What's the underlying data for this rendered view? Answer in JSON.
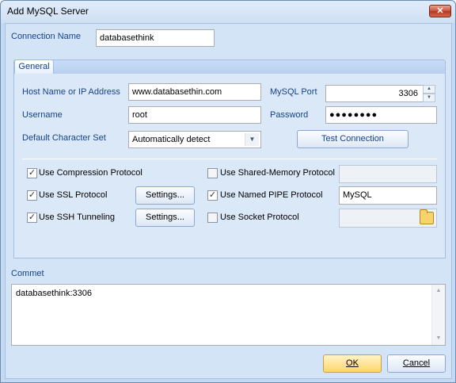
{
  "window": {
    "title": "Add MySQL Server",
    "close_label": "✕"
  },
  "connection": {
    "label": "Connection Name",
    "value": "databasethink"
  },
  "tabs": [
    {
      "label": "General"
    }
  ],
  "general": {
    "host_label": "Host Name or IP Address",
    "host_value": "www.databasethin.com",
    "port_label": "MySQL Port",
    "port_value": "3306",
    "username_label": "Username",
    "username_value": "root",
    "password_label": "Password",
    "password_value": "●●●●●●●●",
    "charset_label": "Default Character Set",
    "charset_value": "Automatically detect",
    "test_connection_label": "Test Connection"
  },
  "options": {
    "compression": {
      "label": "Use Compression Protocol",
      "checked": true
    },
    "ssl": {
      "label": "Use SSL Protocol",
      "checked": true,
      "settings_label": "Settings..."
    },
    "ssh": {
      "label": "Use SSH Tunneling",
      "checked": true,
      "settings_label": "Settings..."
    },
    "shared_memory": {
      "label": "Use Shared-Memory Protocol",
      "checked": false,
      "value": ""
    },
    "named_pipe": {
      "label": "Use Named PIPE Protocol",
      "checked": true,
      "value": "MySQL"
    },
    "socket": {
      "label": "Use Socket Protocol",
      "checked": false,
      "value": ""
    }
  },
  "comment": {
    "label": "Commet",
    "value": "databasethink:3306"
  },
  "footer": {
    "ok_label": "OK",
    "cancel_label": "Cancel"
  },
  "icons": {
    "folder": "folder-open-icon",
    "check": "✓"
  }
}
